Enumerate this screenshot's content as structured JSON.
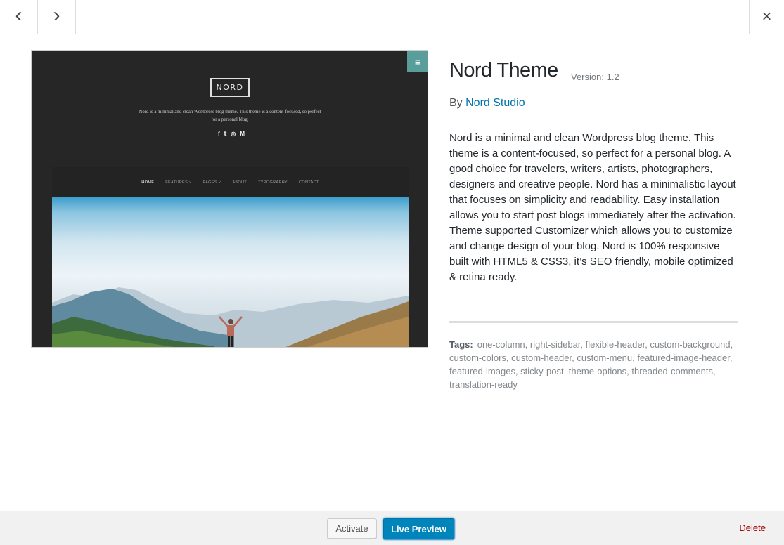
{
  "nav": {
    "prev_icon": "‹",
    "next_icon": "›",
    "close_icon": "×"
  },
  "screenshot": {
    "menu_icon": "≡",
    "logo": "NORD",
    "tagline": "Nord is a minimal and clean Wordpress blog theme. This theme is a content-focused, so perfect for a personal blog.",
    "socials": [
      "f",
      "𝕥",
      "◎",
      "M"
    ],
    "menu": [
      "HOME",
      "FEATURES ˅",
      "PAGES ˅",
      "ABOUT",
      "TYPOGRAPHY",
      "CONTACT"
    ]
  },
  "theme": {
    "name": "Nord Theme",
    "version": "Version: 1.2",
    "author_prefix": "By",
    "author": "Nord Studio",
    "description": "Nord is a minimal and clean Wordpress blog theme. This theme is a content-focused, so perfect for a personal blog. A good choice for travelers, writers, artists, photographers, designers and creative people. Nord has a minimalistic layout that focuses on simplicity and readability. Easy installation allows you to start post blogs immediately after the activation. Theme supported Customizer which allows you to customize and change design of your blog. Nord is 100% responsive built with HTML5 & CSS3, it’s SEO friendly, mobile optimized & retina ready.",
    "tags_label": "Tags:",
    "tags": "one-column, right-sidebar, flexible-header, custom-background, custom-colors, custom-header, custom-menu, featured-image-header, featured-images, sticky-post, theme-options, threaded-comments, translation-ready"
  },
  "footer": {
    "activate": "Activate",
    "live_preview": "Live Preview",
    "delete": "Delete"
  },
  "colors": {
    "link": "#0073aa",
    "primary_button": "#0085ba",
    "delete": "#aa0000",
    "preview_accent": "#5a9e9c"
  }
}
